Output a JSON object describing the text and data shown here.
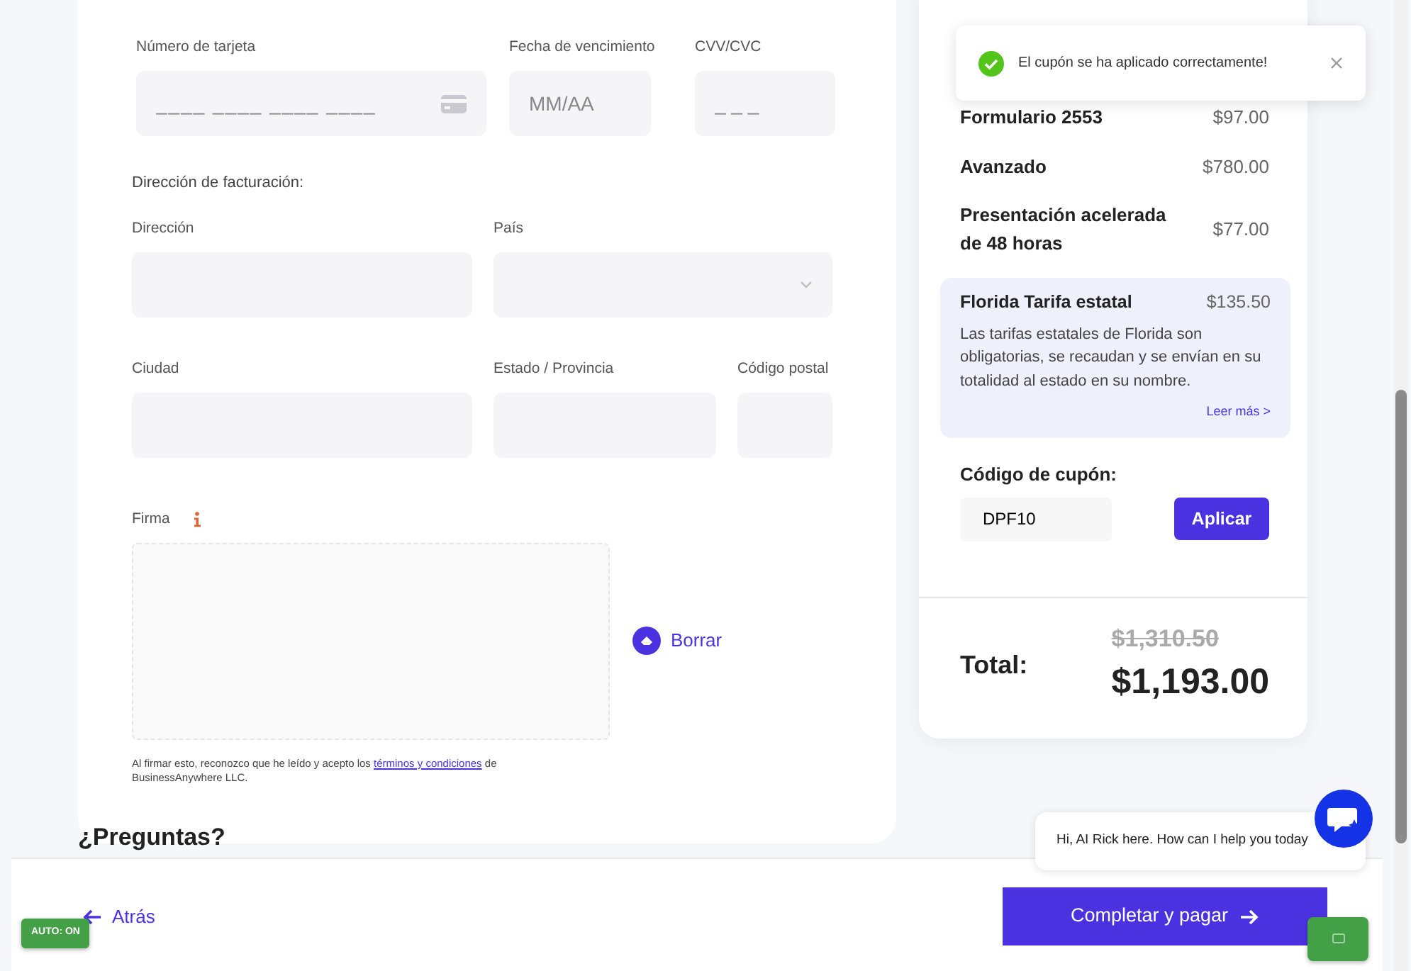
{
  "payment": {
    "card_number": {
      "label": "Número de tarjeta",
      "placeholder": "____ ____ ____ ____"
    },
    "expiry": {
      "label": "Fecha de vencimiento",
      "placeholder": "MM/AA"
    },
    "cvv": {
      "label": "CVV/CVC",
      "placeholder": "_ _ _"
    }
  },
  "billing": {
    "heading": "Dirección de facturación:",
    "fields": [
      {
        "label": "Dirección",
        "kind": "text"
      },
      {
        "label": "País",
        "kind": "select"
      },
      {
        "label": "Ciudad",
        "kind": "text"
      },
      {
        "label": "Estado / Provincia",
        "kind": "text"
      },
      {
        "label": "Código postal",
        "kind": "text"
      }
    ]
  },
  "signature": {
    "label": "Firma",
    "clear_button": "Borrar",
    "terms_before": "Al firmar esto, reconozco que he leído y acepto los ",
    "terms_link": "términos y condiciones",
    "terms_after": " de BusinessAnywhere LLC."
  },
  "questions_heading": "¿Preguntas?",
  "summary": {
    "items": [
      {
        "name": "Formulario 2553",
        "price": "$97.00"
      },
      {
        "name": "Avanzado",
        "price": "$780.00"
      },
      {
        "name": "Presentación acelerada de 48 horas",
        "price": "$77.00"
      }
    ],
    "state_fee": {
      "name": "Florida Tarifa estatal",
      "price": "$135.50",
      "description": "Las tarifas estatales de Florida son obligatorias, se recaudan y se envían en su totalidad al estado en su nombre.",
      "read_more": "Leer más >"
    },
    "coupon": {
      "label": "Código de cupón:",
      "value": "DPF10",
      "button": "Aplicar"
    },
    "total": {
      "label": "Total:",
      "original": "$1,310.50",
      "final": "$1,193.00"
    }
  },
  "toast": {
    "message": "El cupón se ha aplicado correctamente!"
  },
  "chat": {
    "message": "Hi, AI Rick here. How can I help you today"
  },
  "footer": {
    "back": "Atrás",
    "submit": "Completar y pagar"
  },
  "auto_badge": "AUTO: ON"
}
